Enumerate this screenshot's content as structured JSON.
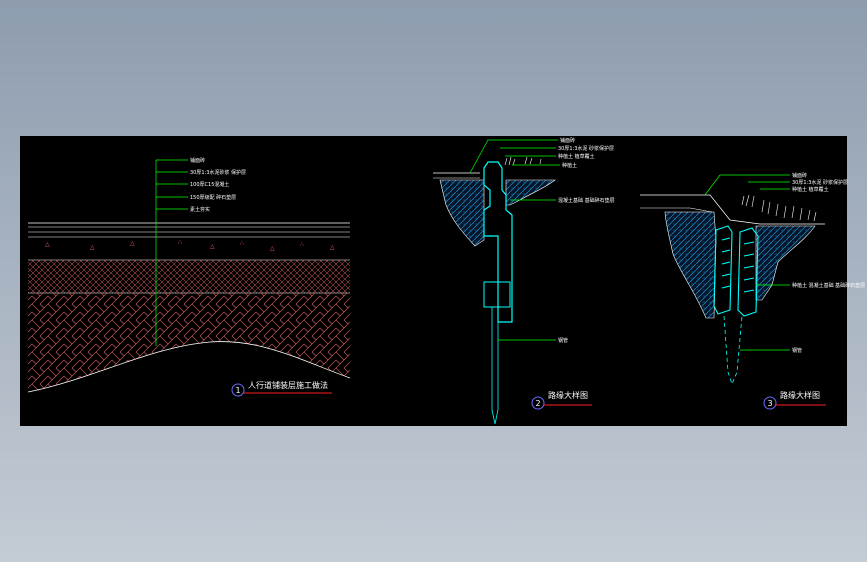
{
  "colors": {
    "canvas": "#000000",
    "leader": "#00ff00",
    "hatch": "#e06060",
    "soil": "#0080c0",
    "curb": "#00ffff",
    "title_circle": "#6a6aff",
    "title_line": "#ff2020",
    "edge": "#ffffff"
  },
  "drawing_1": {
    "title": "人行道铺装层施工做法",
    "number": "1",
    "layers": [
      "铺面砖",
      "30厚1:3水泥砂浆 保护层",
      "100厚C15混凝土",
      "150厚级配 碎石垫层",
      "素土夯实"
    ]
  },
  "drawing_2": {
    "title": "路缘大样图",
    "number": "2",
    "labels": [
      "铺面砖",
      "30厚1:3水泥 砂浆保护层",
      "种植土 植草覆土",
      "种植土",
      "混凝土基础 基础碎石垫层",
      "钢管"
    ]
  },
  "drawing_3": {
    "title": "路缘大样图",
    "number": "3",
    "labels": [
      "铺面砖",
      "30厚1:3水泥 砂浆保护层",
      "种植土 植草覆土",
      "种植土 混凝土基础 基础碎石垫层",
      "钢管"
    ]
  }
}
